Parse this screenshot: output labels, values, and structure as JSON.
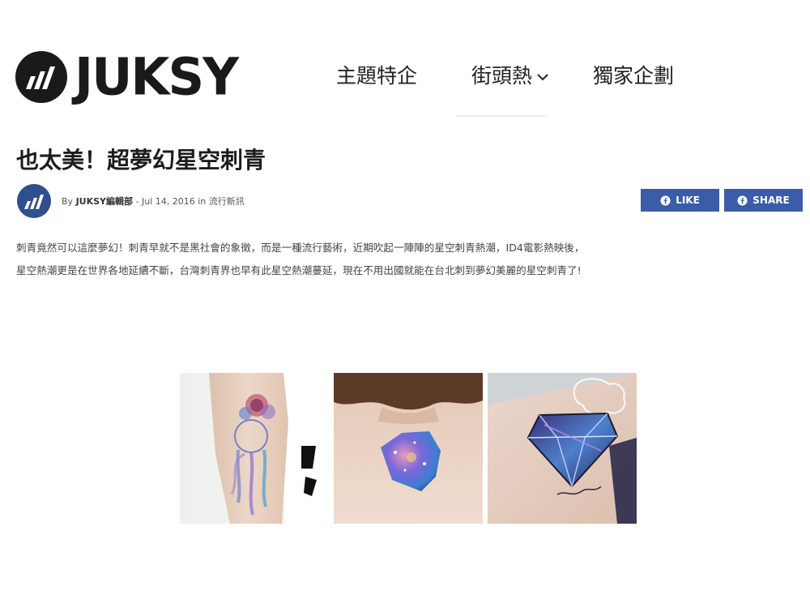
{
  "site": {
    "logo_text": "JUKSY"
  },
  "nav": {
    "items": [
      {
        "label": "主題特企"
      },
      {
        "label": "街頭熱"
      },
      {
        "label": "獨家企劃"
      }
    ]
  },
  "article": {
    "title": "也太美！超夢幻星空刺青",
    "meta": {
      "by_prefix": "By",
      "author": "JUKSY編輯部",
      "separator": "-",
      "date": "Jul 14, 2016",
      "in_prefix": "in",
      "category": "流行新訊"
    },
    "social": {
      "like_label": "LIKE",
      "share_label": "SHARE"
    },
    "paragraph_lines": [
      "刺青竟然可以這麼夢幻！刺青早就不是黑社會的象徵，而是一種流行藝術，近期吹起一陣陣的星空刺青熱潮，ID4電影熱映後，",
      "星空熱潮更是在世界各地延續不斷，台灣刺青界也早有此星空熱潮蔓延，現在不用出國就能在台北刺到夢幻美麗的星空刺青了!"
    ],
    "photos": [
      {
        "icon": "dreamcatcher-tattoo-photo"
      },
      {
        "icon": "gem-back-tattoo-photo"
      },
      {
        "icon": "diamond-arm-tattoo-photo"
      }
    ]
  },
  "colors": {
    "facebook_blue": "#3b5ca8",
    "logo_black": "#1a1a1a"
  }
}
